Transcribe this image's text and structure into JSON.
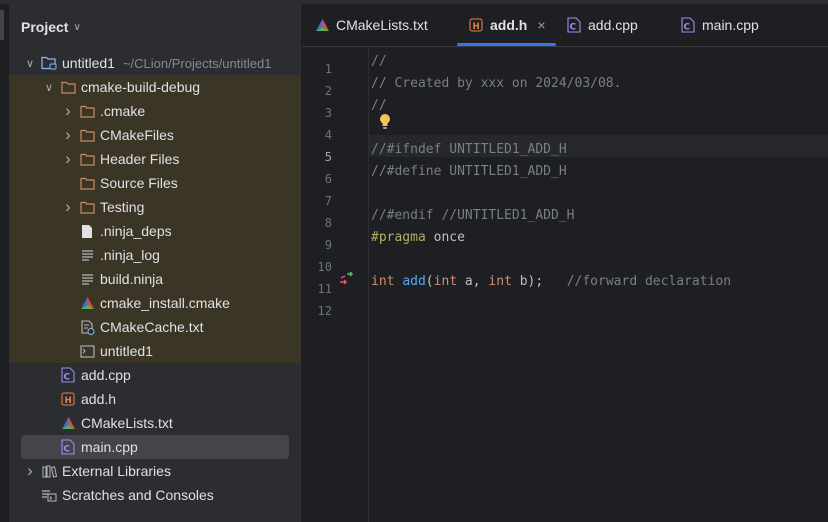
{
  "panel": {
    "title": "Project",
    "tree": [
      {
        "label": "untitled1",
        "hint": "~/CLion/Projects/untitled1",
        "icon": "module-folder-icon",
        "arrow": "expanded",
        "indent": 0
      },
      {
        "label": "cmake-build-debug",
        "icon": "folder-icon",
        "arrow": "expanded",
        "indent": 1
      },
      {
        "label": ".cmake",
        "icon": "folder-icon",
        "arrow": "collapsed",
        "indent": 2
      },
      {
        "label": "CMakeFiles",
        "icon": "folder-icon",
        "arrow": "collapsed",
        "indent": 2
      },
      {
        "label": "Header Files",
        "icon": "folder-icon",
        "arrow": "collapsed",
        "indent": 2
      },
      {
        "label": "Source Files",
        "icon": "folder-icon",
        "arrow": "none",
        "indent": 2
      },
      {
        "label": "Testing",
        "icon": "folder-icon",
        "arrow": "collapsed",
        "indent": 2
      },
      {
        "label": ".ninja_deps",
        "icon": "file-icon",
        "arrow": "none",
        "indent": 2
      },
      {
        "label": ".ninja_log",
        "icon": "text-file-icon",
        "arrow": "none",
        "indent": 2
      },
      {
        "label": "build.ninja",
        "icon": "text-file-icon",
        "arrow": "none",
        "indent": 2
      },
      {
        "label": "cmake_install.cmake",
        "icon": "cmake-icon",
        "arrow": "none",
        "indent": 2
      },
      {
        "label": "CMakeCache.txt",
        "icon": "cmake-cache-icon",
        "arrow": "none",
        "indent": 2
      },
      {
        "label": "untitled1",
        "icon": "executable-icon",
        "arrow": "none",
        "indent": 2
      },
      {
        "label": "add.cpp",
        "icon": "cpp-file-icon",
        "arrow": "none",
        "indent": 1
      },
      {
        "label": "add.h",
        "icon": "header-file-icon",
        "arrow": "none",
        "indent": 1
      },
      {
        "label": "CMakeLists.txt",
        "icon": "cmake-icon",
        "arrow": "none",
        "indent": 1
      },
      {
        "label": "main.cpp",
        "icon": "cpp-file-icon",
        "arrow": "none",
        "indent": 1,
        "selected": true
      },
      {
        "label": "External Libraries",
        "icon": "libraries-icon",
        "arrow": "collapsed",
        "indent": 0
      },
      {
        "label": "Scratches and Consoles",
        "icon": "scratches-icon",
        "arrow": "none",
        "indent": 0
      }
    ]
  },
  "tabs": [
    {
      "label": "CMakeLists.txt",
      "icon": "cmake-icon"
    },
    {
      "label": "add.h",
      "icon": "header-file-icon",
      "active": true,
      "close": "×"
    },
    {
      "label": "add.cpp",
      "icon": "cpp-file-icon"
    },
    {
      "label": "main.cpp",
      "icon": "cpp-file-icon"
    }
  ],
  "editor": {
    "current_line": 5,
    "lines": [
      {
        "n": "1",
        "tokens": [
          {
            "t": "//",
            "c": "cmt"
          }
        ]
      },
      {
        "n": "2",
        "tokens": [
          {
            "t": "// Created by xxx on 2024/03/08.",
            "c": "cmt"
          }
        ]
      },
      {
        "n": "3",
        "tokens": [
          {
            "t": "//",
            "c": "cmt"
          }
        ]
      },
      {
        "n": "4",
        "tokens": []
      },
      {
        "n": "5",
        "tokens": [
          {
            "t": "//#ifndef UNTITLED1_ADD_H",
            "c": "cmt"
          }
        ]
      },
      {
        "n": "6",
        "tokens": [
          {
            "t": "//#define UNTITLED1_ADD_H",
            "c": "cmt"
          }
        ]
      },
      {
        "n": "7",
        "tokens": []
      },
      {
        "n": "8",
        "tokens": [
          {
            "t": "//#endif //UNTITLED1_ADD_H",
            "c": "cmt"
          }
        ]
      },
      {
        "n": "9",
        "tokens": [
          {
            "t": "#pragma",
            "c": "pre"
          },
          {
            "t": " once",
            "c": ""
          }
        ]
      },
      {
        "n": "10",
        "tokens": []
      },
      {
        "n": "11",
        "tokens": [
          {
            "t": "int",
            "c": "kw"
          },
          {
            "t": " ",
            "c": ""
          },
          {
            "t": "add",
            "c": "fn"
          },
          {
            "t": "(",
            "c": ""
          },
          {
            "t": "int",
            "c": "kw"
          },
          {
            "t": " a, ",
            "c": ""
          },
          {
            "t": "int",
            "c": "kw"
          },
          {
            "t": " b);   ",
            "c": ""
          },
          {
            "t": "//forward declaration",
            "c": "cmt"
          }
        ]
      },
      {
        "n": "12",
        "tokens": []
      }
    ]
  },
  "colors": {
    "accent": "#3574f0",
    "panel_bg": "#2b2d30",
    "editor_bg": "#1e1f22",
    "highlight_row": "#3b3525"
  }
}
